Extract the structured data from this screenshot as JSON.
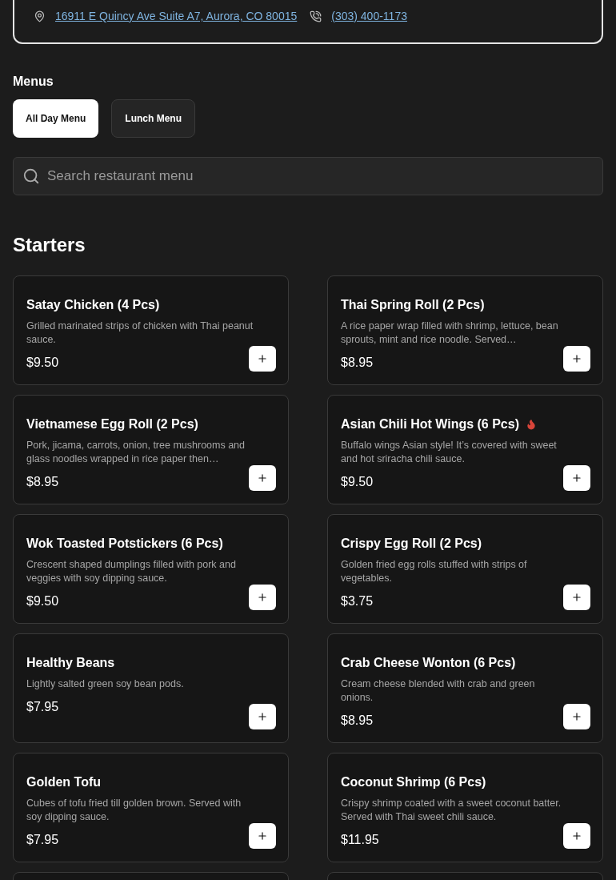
{
  "location": {
    "address": "16911 E Quincy Ave Suite A7, Aurora, CO 80015",
    "phone": "(303) 400-1173"
  },
  "menus": {
    "title": "Menus",
    "tabs": [
      {
        "label": "All Day Menu",
        "selected": true
      },
      {
        "label": "Lunch Menu",
        "selected": false
      }
    ]
  },
  "search": {
    "placeholder": "Search restaurant menu"
  },
  "section": {
    "title": "Starters",
    "items": [
      {
        "name": "Satay Chicken (4 Pcs)",
        "description": "Grilled marinated strips of chicken with Thai peanut sauce.",
        "price": "$9.50",
        "spicy": false
      },
      {
        "name": "Thai Spring Roll (2 Pcs)",
        "description": "A rice paper wrap filled with shrimp, lettuce, bean sprouts, mint and rice noodle. Served…",
        "price": "$8.95",
        "spicy": false
      },
      {
        "name": "Vietnamese Egg Roll (2 Pcs)",
        "description": "Pork, jicama, carrots, onion, tree mushrooms and glass noodles wrapped in rice paper then…",
        "price": "$8.95",
        "spicy": false
      },
      {
        "name": "Asian Chili Hot Wings (6 Pcs)",
        "description": "Buffalo wings Asian style! It’s covered with sweet and hot sriracha chili sauce.",
        "price": "$9.50",
        "spicy": true
      },
      {
        "name": "Wok Toasted Potstickers (6 Pcs)",
        "description": "Crescent shaped dumplings filled with pork and veggies with soy dipping sauce.",
        "price": "$9.50",
        "spicy": false
      },
      {
        "name": "Crispy Egg Roll (2 Pcs)",
        "description": "Golden fried egg rolls stuffed with strips of vegetables.",
        "price": "$3.75",
        "spicy": false
      },
      {
        "name": "Healthy Beans",
        "description": "Lightly salted green soy bean pods.",
        "price": "$7.95",
        "spicy": false
      },
      {
        "name": "Crab Cheese Wonton (6 Pcs)",
        "description": "Cream cheese blended with crab and green onions.",
        "price": "$8.95",
        "spicy": false
      },
      {
        "name": "Golden Tofu",
        "description": "Cubes of tofu fried till golden brown. Served with soy dipping sauce.",
        "price": "$7.95",
        "spicy": false
      },
      {
        "name": "Coconut Shrimp (6 Pcs)",
        "description": "Crispy shrimp coated with a sweet coconut batter. Served with Thai sweet chili sauce.",
        "price": "$11.95",
        "spicy": false
      }
    ]
  }
}
